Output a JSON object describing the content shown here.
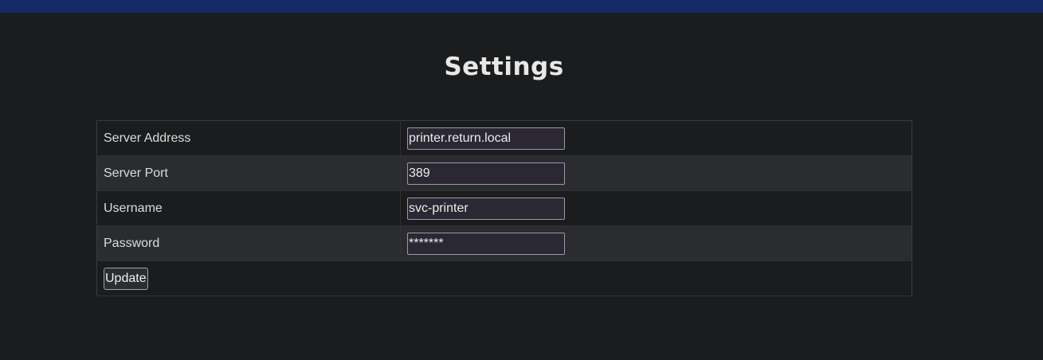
{
  "header": {
    "bar_color": "#142a68"
  },
  "page": {
    "title": "Settings"
  },
  "form": {
    "fields": [
      {
        "label": "Server Address",
        "value": "printer.return.local",
        "type": "text"
      },
      {
        "label": "Server Port",
        "value": "389",
        "type": "text"
      },
      {
        "label": "Username",
        "value": "svc-printer",
        "type": "text"
      },
      {
        "label": "Password",
        "value": "*******",
        "type": "text"
      }
    ],
    "submit_label": "Update"
  }
}
